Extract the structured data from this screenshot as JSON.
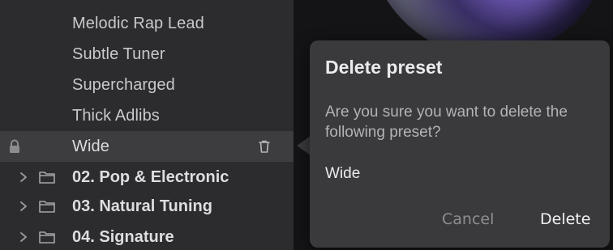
{
  "presets": [
    {
      "label": "Melodic Rap Lead"
    },
    {
      "label": "Subtle Tuner"
    },
    {
      "label": "Supercharged"
    },
    {
      "label": "Thick Adlibs"
    },
    {
      "label": "Wide",
      "selected": true
    }
  ],
  "folders": [
    {
      "label": "02. Pop & Electronic"
    },
    {
      "label": "03. Natural Tuning"
    },
    {
      "label": "04. Signature"
    }
  ],
  "dialog": {
    "title": "Delete preset",
    "message": "Are you sure you want to delete the following preset?",
    "preset_name": "Wide",
    "cancel_label": "Cancel",
    "delete_label": "Delete"
  },
  "colors": {
    "browser_bg": "#2c2c2e",
    "selected_row_bg": "#3d3d40",
    "dialog_bg": "#3a3a3d",
    "accent_purple": "#7a63c4"
  },
  "icons": {
    "lock": "lock-icon",
    "trash": "trash-icon",
    "folder": "folder-icon",
    "chevron": "chevron-right-icon"
  }
}
